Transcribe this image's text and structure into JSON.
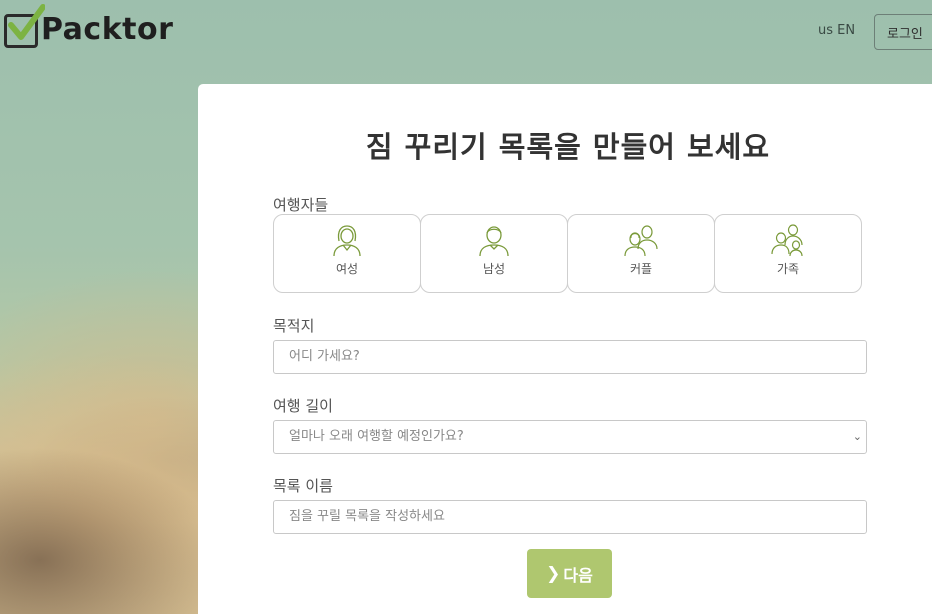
{
  "header": {
    "logo_text": "Packtor",
    "lang_label": "us EN",
    "login_label": "로그인"
  },
  "form": {
    "title": "짐 꾸리기 목록을 만들어 보세요",
    "travelers_label": "여행자들",
    "travelers": [
      {
        "label": "여성",
        "icon": "woman-icon"
      },
      {
        "label": "남성",
        "icon": "man-icon"
      },
      {
        "label": "커플",
        "icon": "couple-icon"
      },
      {
        "label": "가족",
        "icon": "family-icon"
      }
    ],
    "destination_label": "목적지",
    "destination_placeholder": "어디 가세요?",
    "duration_label": "여행 길이",
    "duration_placeholder": "얼마나 오래 여행할 예정인가요?",
    "list_name_label": "목록 이름",
    "list_name_placeholder": "짐을 꾸릴 목록을 작성하세요",
    "next_label": "다음"
  },
  "colors": {
    "accent": "#afc76f",
    "icon_green": "#7a9a3a",
    "logo_check": "#7cb342"
  }
}
